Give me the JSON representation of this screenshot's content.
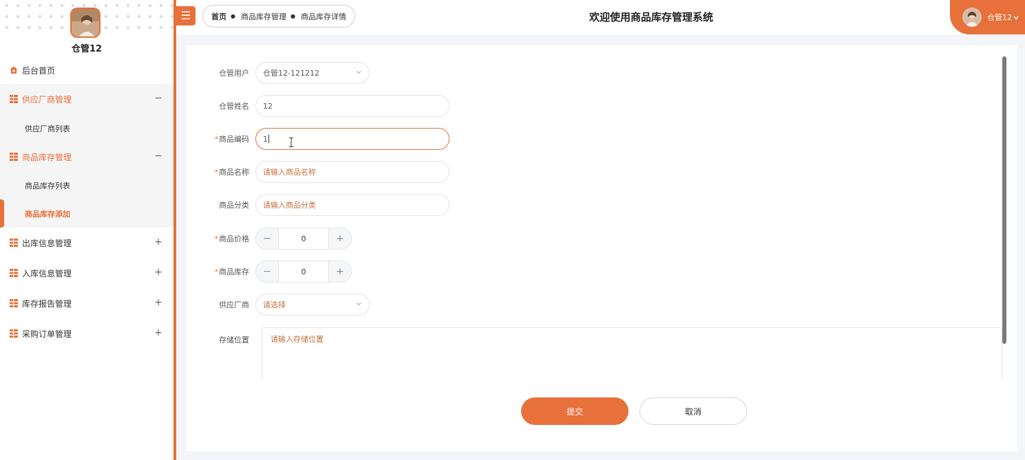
{
  "app": {
    "title": "欢迎使用商品库存管理系统"
  },
  "user": {
    "name": "仓管12",
    "header_name": "仓管12"
  },
  "breadcrumb": [
    "首页",
    "商品库存管理",
    "商品库存详情"
  ],
  "menu": {
    "home": "后台首页",
    "groups": [
      {
        "label": "供应厂商管理",
        "toggle": "−",
        "sub": [
          "供应厂商列表"
        ]
      },
      {
        "label": "商品库存管理",
        "toggle": "−",
        "sub": [
          "商品库存列表",
          "商品库存添加"
        ]
      },
      {
        "label": "出库信息管理",
        "toggle": "+"
      },
      {
        "label": "入库信息管理",
        "toggle": "+"
      },
      {
        "label": "库存报告管理",
        "toggle": "+"
      },
      {
        "label": "采购订单管理",
        "toggle": "+"
      }
    ]
  },
  "form": {
    "user": {
      "label": "仓管用户",
      "value": "仓管12-121212"
    },
    "name": {
      "label": "仓管姓名",
      "value": "12"
    },
    "code": {
      "label": "商品编码",
      "value": "1"
    },
    "goods_name": {
      "label": "商品名称",
      "placeholder": "请输入商品名称"
    },
    "category": {
      "label": "商品分类",
      "placeholder": "请输入商品分类"
    },
    "price": {
      "label": "商品价格",
      "value": "0",
      "minus": "−",
      "plus": "+"
    },
    "stock": {
      "label": "商品库存",
      "value": "0",
      "minus": "−",
      "plus": "+"
    },
    "supplier": {
      "label": "供应厂商",
      "placeholder": "请选择"
    },
    "location": {
      "label": "存储位置",
      "placeholder": "请输入存储位置"
    },
    "required_mark": "*",
    "submit": "提交",
    "cancel": "取消"
  },
  "colors": {
    "accent": "#e8703a"
  }
}
